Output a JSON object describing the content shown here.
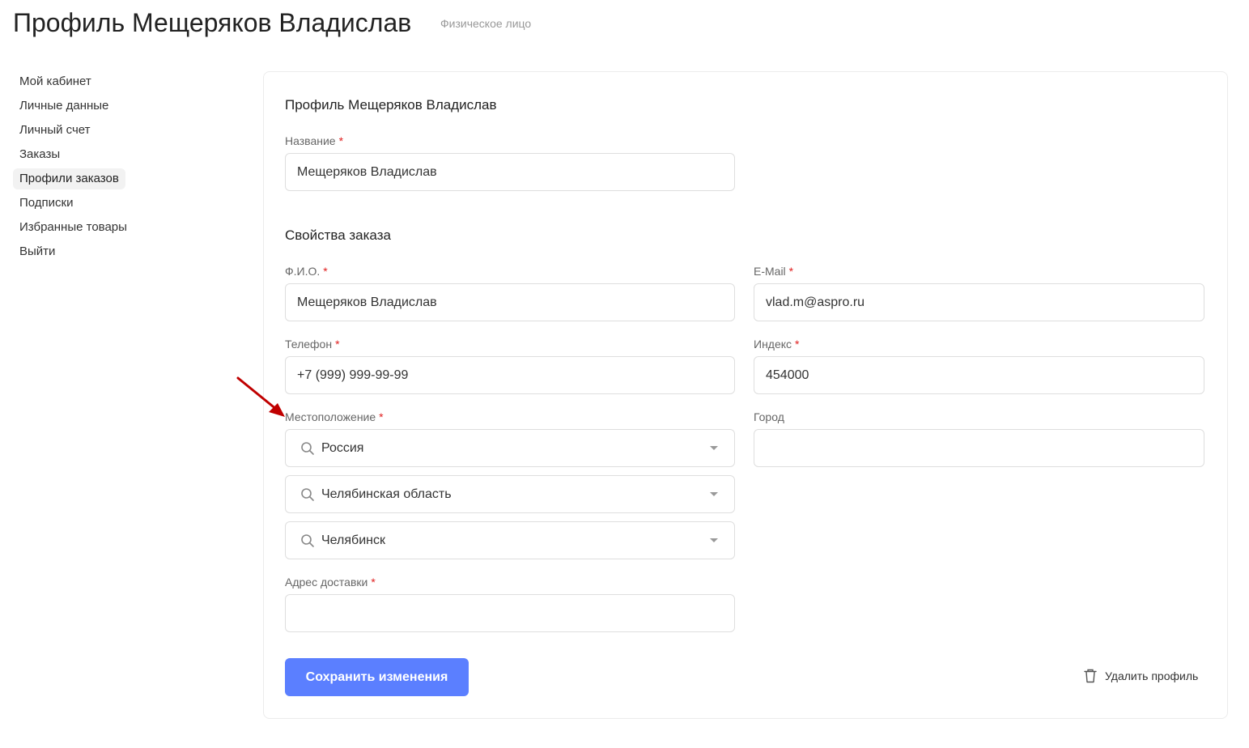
{
  "header": {
    "title": "Профиль Мещеряков Владислав",
    "subtitle": "Физическое лицо"
  },
  "sidebar": {
    "items": [
      {
        "label": "Мой кабинет",
        "active": false
      },
      {
        "label": "Личные данные",
        "active": false
      },
      {
        "label": "Личный счет",
        "active": false
      },
      {
        "label": "Заказы",
        "active": false
      },
      {
        "label": "Профили заказов",
        "active": true
      },
      {
        "label": "Подписки",
        "active": false
      },
      {
        "label": "Избранные товары",
        "active": false
      },
      {
        "label": "Выйти",
        "active": false
      }
    ]
  },
  "form": {
    "profile_title": "Профиль Мещеряков Владислав",
    "name_label": "Название",
    "name_value": "Мещеряков Владислав",
    "order_props_title": "Свойства заказа",
    "fio_label": "Ф.И.О.",
    "fio_value": "Мещеряков Владислав",
    "email_label": "E-Mail",
    "email_value": "vlad.m@aspro.ru",
    "phone_label": "Телефон",
    "phone_value": "+7 (999) 999-99-99",
    "index_label": "Индекс",
    "index_value": "454000",
    "location_label": "Местоположение",
    "location_country": "Россия",
    "location_region": "Челябинская область",
    "location_city": "Челябинск",
    "city_label": "Город",
    "city_value": "",
    "address_label": "Адрес доставки",
    "address_value": "",
    "required_mark": "*",
    "save_label": "Сохранить изменения",
    "delete_label": "Удалить профиль"
  },
  "icons": {
    "search": "search-icon",
    "dropdown": "chevron-down-icon",
    "delete": "trash-icon",
    "annotation": "arrow-icon"
  },
  "colors": {
    "accent": "#5b7fff",
    "required": "#e02020",
    "annotation_arrow": "#c00000"
  }
}
